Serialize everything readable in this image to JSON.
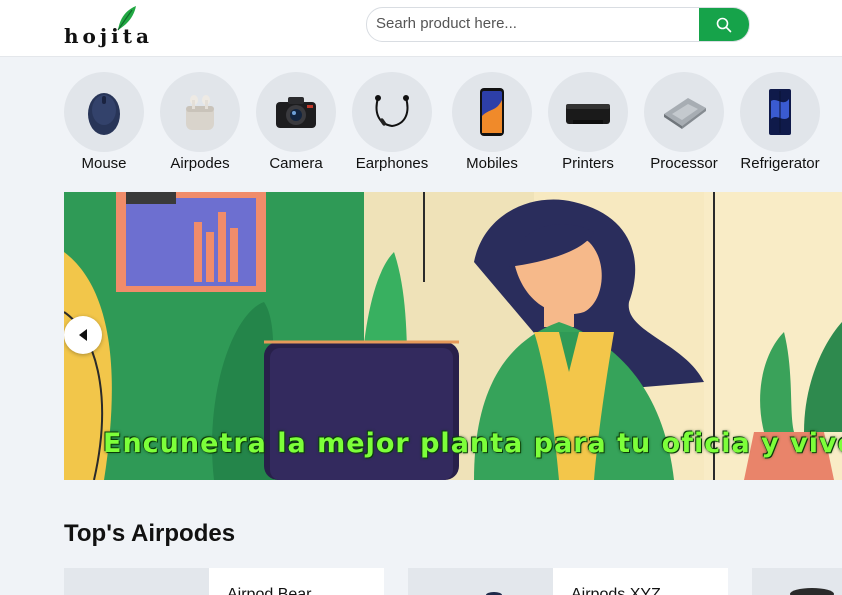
{
  "header": {
    "logo_text": "hojita",
    "search_placeholder": "Searh product here..."
  },
  "categories": [
    {
      "label": "Mouse",
      "icon": "mouse-icon"
    },
    {
      "label": "Airpodes",
      "icon": "airpods-icon"
    },
    {
      "label": "Camera",
      "icon": "camera-icon"
    },
    {
      "label": "Earphones",
      "icon": "earphones-icon"
    },
    {
      "label": "Mobiles",
      "icon": "mobile-icon"
    },
    {
      "label": "Printers",
      "icon": "printer-icon"
    },
    {
      "label": "Processor",
      "icon": "processor-icon"
    },
    {
      "label": "Refrigerator",
      "icon": "refrigerator-icon"
    }
  ],
  "banner": {
    "caption": "Encunetra la mejor planta para tu oficia y vive e"
  },
  "section": {
    "title": "Top's Airpodes"
  },
  "products": [
    {
      "name": "Airpod Bear"
    },
    {
      "name": "Airpods XYZ"
    }
  ],
  "colors": {
    "accent": "#16a34a",
    "page_background": "#f0f3f7"
  }
}
